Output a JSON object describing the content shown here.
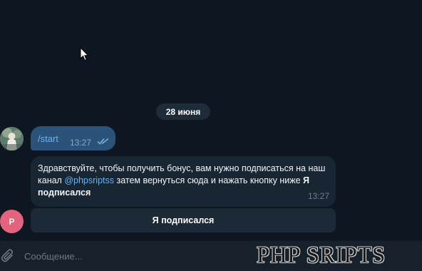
{
  "date_separator": "28 июня",
  "outgoing_message": {
    "text": "/start",
    "time": "13:27",
    "status_icon": "double-check-icon"
  },
  "incoming_message": {
    "text_part1": "Здравствуйте, чтобы получить бонус, вам нужно подписаться на наш канал ",
    "mention": "@phpsriptss",
    "text_part2": " затем вернуться сюда и нажать кнопку ниже ",
    "bold": "Я подписался",
    "time": "13:27"
  },
  "bot_avatar_letter": "P",
  "keyboard_button": "Я подписался",
  "composer": {
    "placeholder": "Сообщение...",
    "attach_icon": "paperclip-icon"
  },
  "watermark": "PHP SRIPTS",
  "colors": {
    "background": "#0e1621",
    "outgoing_bubble": "#2b5278",
    "incoming_bubble": "#182533",
    "link": "#6ab3f3",
    "bot_avatar": "#e4647f"
  }
}
